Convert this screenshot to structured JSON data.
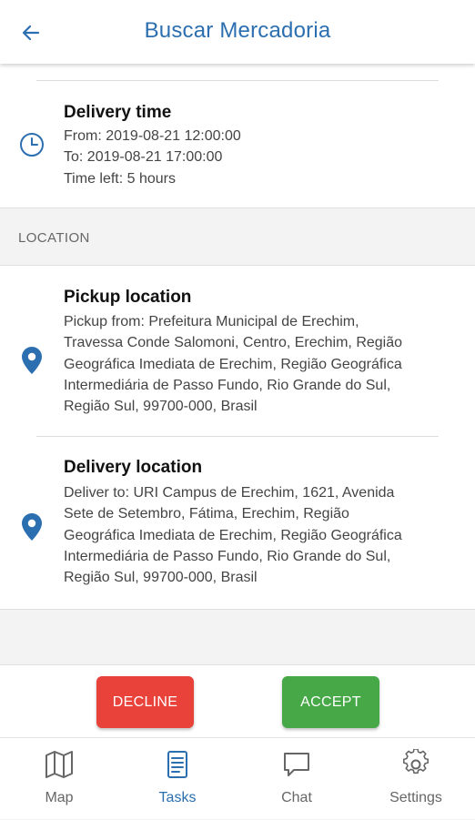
{
  "header": {
    "title": "Buscar Mercadoria",
    "back_icon": "arrow-left-icon"
  },
  "delivery_time": {
    "title": "Delivery time",
    "from": "From: 2019-08-21 12:00:00",
    "to": "To: 2019-08-21 17:00:00",
    "time_left": "Time left: 5 hours",
    "icon": "clock-icon"
  },
  "location_section": {
    "header": "LOCATION",
    "pickup": {
      "title": "Pickup location",
      "lines": [
        "Pickup from: Prefeitura Municipal de Erechim,",
        "Travessa Conde Salomoni, Centro, Erechim, Região",
        "Geográfica Imediata de Erechim, Região Geográfica",
        "Intermediária de Passo Fundo, Rio Grande do Sul,",
        "Região Sul, 99700-000, Brasil"
      ],
      "icon": "map-pin-icon"
    },
    "delivery": {
      "title": "Delivery location",
      "lines": [
        "Deliver to: URI Campus de Erechim, 1621, Avenida",
        "Sete de Setembro, Fátima, Erechim, Região",
        "Geográfica Imediata de Erechim, Região Geográfica",
        "Intermediária de Passo Fundo, Rio Grande do Sul,",
        "Região Sul, 99700-000, Brasil"
      ],
      "icon": "map-pin-icon"
    }
  },
  "actions": {
    "decline_label": "DECLINE",
    "accept_label": "ACCEPT",
    "decline_color": "#e8423a",
    "accept_color": "#47a848"
  },
  "bottom_nav": {
    "items": [
      {
        "label": "Map",
        "icon": "map-icon",
        "active": false
      },
      {
        "label": "Tasks",
        "icon": "tasks-icon",
        "active": true
      },
      {
        "label": "Chat",
        "icon": "chat-icon",
        "active": false
      },
      {
        "label": "Settings",
        "icon": "gear-icon",
        "active": false
      }
    ],
    "active_color": "#2c6fb0"
  }
}
